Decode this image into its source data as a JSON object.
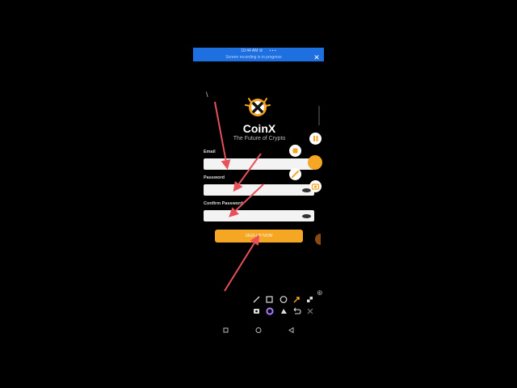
{
  "banner": {
    "status_left": "10:44 AM ⚙",
    "status_right": "▪ ▪ ▪",
    "message": "Screen recording is in progress",
    "close": "✕"
  },
  "app": {
    "back": "\\",
    "brand": "CoinX",
    "tagline": "The Future of Crypto",
    "email_label": "Email",
    "password_label": "Password",
    "confirm_label": "Confirm Password",
    "button_label": "SIGN UP NOW"
  },
  "colors": {
    "banner": "#1e6fe0",
    "accent": "#f5a623",
    "arrow": "#e8505b"
  },
  "tools": {
    "row1": [
      "pen-icon",
      "square-icon",
      "circle-icon",
      "arrow-icon",
      "mosaic-icon"
    ],
    "row2": [
      "camera-icon",
      "color-icon",
      "eraser-icon",
      "undo-icon",
      "close-icon"
    ]
  },
  "nav": [
    "recents-icon",
    "home-icon",
    "back-icon"
  ]
}
